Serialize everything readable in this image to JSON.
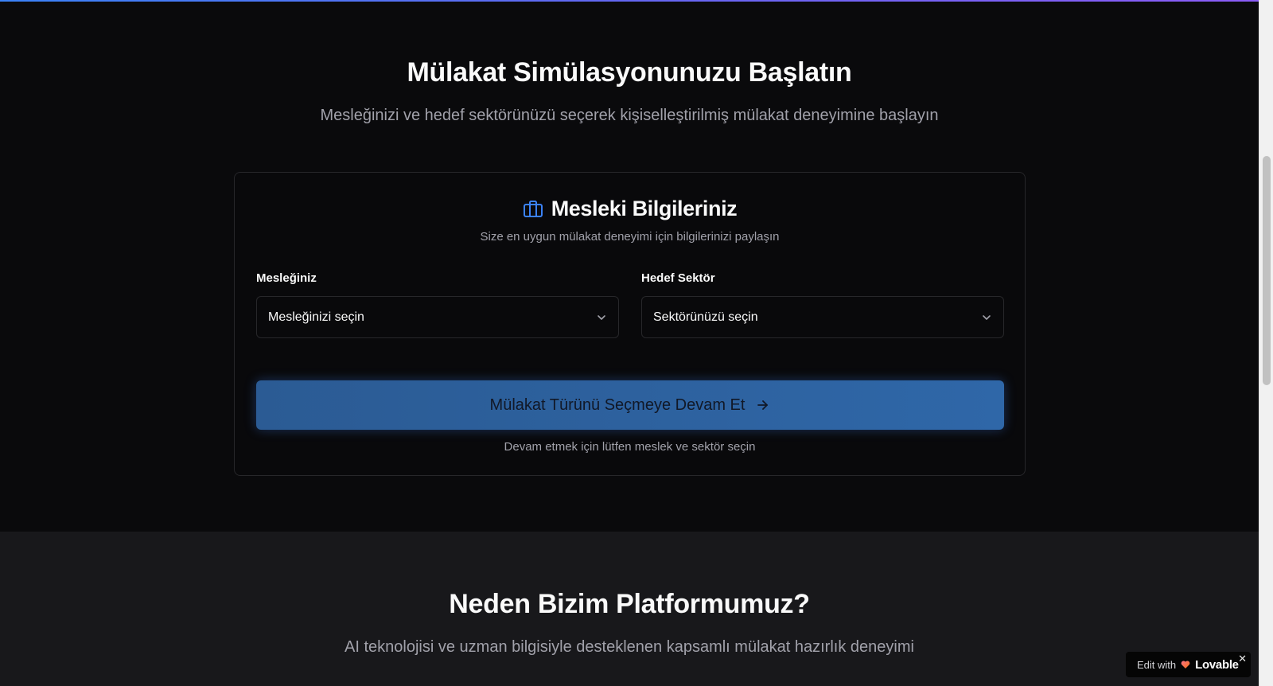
{
  "hero": {
    "title": "Mülakat Simülasyonunuzu Başlatın",
    "subtitle": "Mesleğinizi ve hedef sektörünüzü seçerek kişiselleştirilmiş mülakat deneyimine başlayın"
  },
  "card": {
    "icon": "briefcase-icon",
    "title": "Mesleki Bilgileriniz",
    "description": "Size en uygun mülakat deneyimi için bilgilerinizi paylaşın",
    "profession": {
      "label": "Mesleğiniz",
      "placeholder": "Mesleğinizi seçin"
    },
    "sector": {
      "label": "Hedef Sektör",
      "placeholder": "Sektörünüzü seçin"
    },
    "continue_button": "Mülakat Türünü Seçmeye Devam Et",
    "helper_text": "Devam etmek için lütfen meslek ve sektör seçin"
  },
  "why": {
    "title": "Neden Bizim Platformumuz?",
    "subtitle": "AI teknolojisi ve uzman bilgisiyle desteklenen kapsamlı mülakat hazırlık deneyimi"
  },
  "badge": {
    "prefix": "Edit with",
    "brand": "Lovable",
    "close": "✕"
  },
  "colors": {
    "accent": "#3b82f6",
    "button": "#2f67a8",
    "background": "#0a0a0c",
    "section_alt": "#18181b"
  }
}
